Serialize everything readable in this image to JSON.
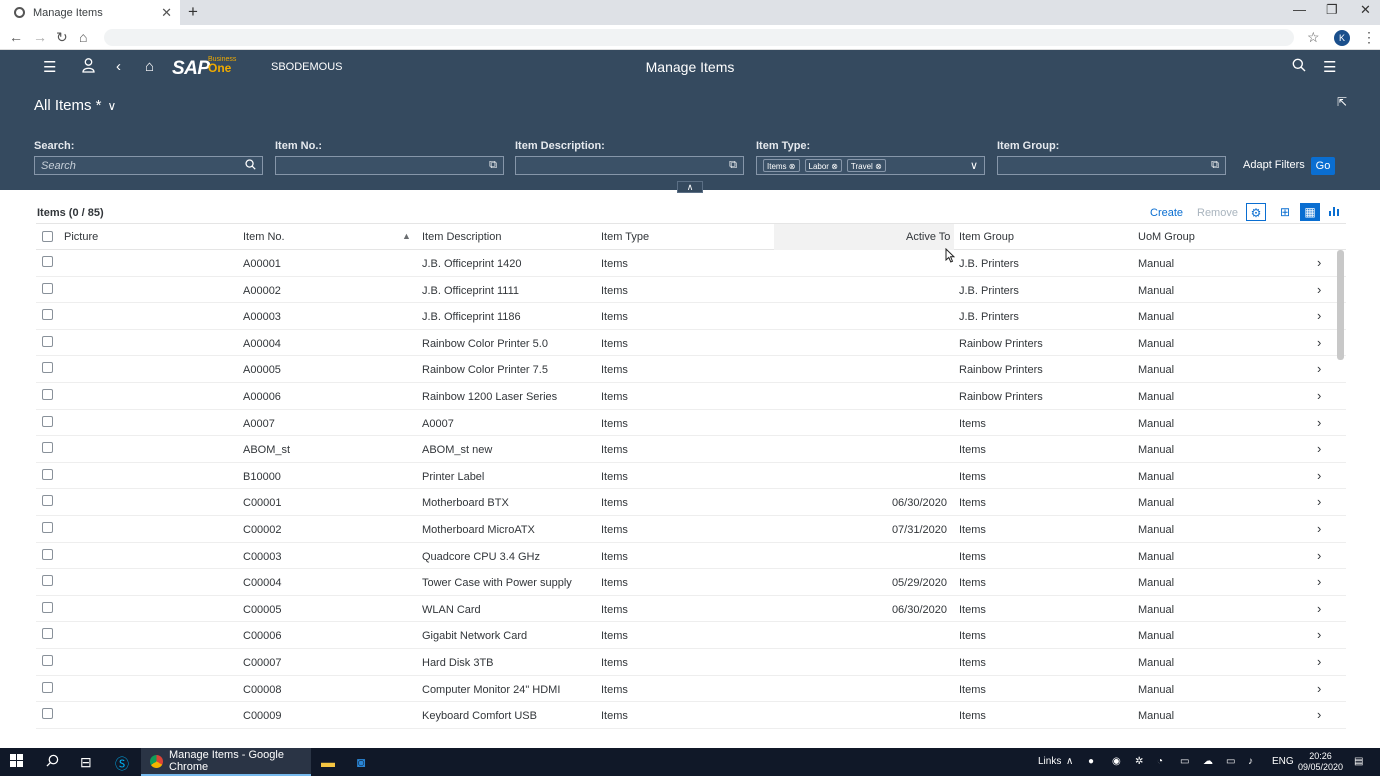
{
  "browser": {
    "tab_title": "Manage Items",
    "new_tab": "+",
    "tab_close": "✕",
    "avatar_letter": "K"
  },
  "shell": {
    "logo_text": "SAP",
    "logo_business": "Business",
    "logo_one": "One",
    "company": "SBODEMOUS",
    "title": "Manage Items"
  },
  "header": {
    "variant": "All Items *",
    "filters": {
      "search_label": "Search:",
      "search_placeholder": "Search",
      "item_no_label": "Item No.:",
      "item_desc_label": "Item Description:",
      "item_type_label": "Item Type:",
      "item_type_tokens": [
        "Items",
        "Labor",
        "Travel"
      ],
      "item_group_label": "Item Group:"
    },
    "adapt_filters": "Adapt Filters",
    "go": "Go"
  },
  "table": {
    "title": "Items (0 / 85)",
    "create": "Create",
    "remove": "Remove",
    "columns": [
      "Picture",
      "Item No.",
      "Item Description",
      "Item Type",
      "Active To",
      "Item Group",
      "UoM Group"
    ],
    "rows": [
      {
        "no": "A00001",
        "desc": "J.B. Officeprint 1420",
        "type": "Items",
        "active_to": "",
        "group": "J.B. Printers",
        "uom": "Manual"
      },
      {
        "no": "A00002",
        "desc": "J.B. Officeprint 1111",
        "type": "Items",
        "active_to": "",
        "group": "J.B. Printers",
        "uom": "Manual"
      },
      {
        "no": "A00003",
        "desc": "J.B. Officeprint 1186",
        "type": "Items",
        "active_to": "",
        "group": "J.B. Printers",
        "uom": "Manual"
      },
      {
        "no": "A00004",
        "desc": "Rainbow Color Printer 5.0",
        "type": "Items",
        "active_to": "",
        "group": "Rainbow Printers",
        "uom": "Manual"
      },
      {
        "no": "A00005",
        "desc": "Rainbow Color Printer 7.5",
        "type": "Items",
        "active_to": "",
        "group": "Rainbow Printers",
        "uom": "Manual"
      },
      {
        "no": "A00006",
        "desc": "Rainbow 1200 Laser Series",
        "type": "Items",
        "active_to": "",
        "group": "Rainbow Printers",
        "uom": "Manual"
      },
      {
        "no": "A0007",
        "desc": "A0007",
        "type": "Items",
        "active_to": "",
        "group": "Items",
        "uom": "Manual"
      },
      {
        "no": "ABOM_st",
        "desc": "ABOM_st new",
        "type": "Items",
        "active_to": "",
        "group": "Items",
        "uom": "Manual"
      },
      {
        "no": "B10000",
        "desc": "Printer Label",
        "type": "Items",
        "active_to": "",
        "group": "Items",
        "uom": "Manual"
      },
      {
        "no": "C00001",
        "desc": "Motherboard BTX",
        "type": "Items",
        "active_to": "06/30/2020",
        "group": "Items",
        "uom": "Manual"
      },
      {
        "no": "C00002",
        "desc": "Motherboard MicroATX",
        "type": "Items",
        "active_to": "07/31/2020",
        "group": "Items",
        "uom": "Manual"
      },
      {
        "no": "C00003",
        "desc": "Quadcore CPU 3.4 GHz",
        "type": "Items",
        "active_to": "",
        "group": "Items",
        "uom": "Manual"
      },
      {
        "no": "C00004",
        "desc": "Tower Case with Power supply",
        "type": "Items",
        "active_to": "05/29/2020",
        "group": "Items",
        "uom": "Manual"
      },
      {
        "no": "C00005",
        "desc": "WLAN Card",
        "type": "Items",
        "active_to": "06/30/2020",
        "group": "Items",
        "uom": "Manual"
      },
      {
        "no": "C00006",
        "desc": "Gigabit Network Card",
        "type": "Items",
        "active_to": "",
        "group": "Items",
        "uom": "Manual"
      },
      {
        "no": "C00007",
        "desc": "Hard Disk 3TB",
        "type": "Items",
        "active_to": "",
        "group": "Items",
        "uom": "Manual"
      },
      {
        "no": "C00008",
        "desc": "Computer Monitor 24\" HDMI",
        "type": "Items",
        "active_to": "",
        "group": "Items",
        "uom": "Manual"
      },
      {
        "no": "C00009",
        "desc": "Keyboard Comfort USB",
        "type": "Items",
        "active_to": "",
        "group": "Items",
        "uom": "Manual"
      }
    ]
  },
  "taskbar": {
    "active_window": "Manage Items - Google Chrome",
    "links": "Links",
    "lang": "ENG",
    "time": "20:26",
    "date": "09/05/2020"
  },
  "colors": {
    "shell": "#354a5f",
    "accent": "#0a6ed1",
    "taskbar": "#101828"
  }
}
